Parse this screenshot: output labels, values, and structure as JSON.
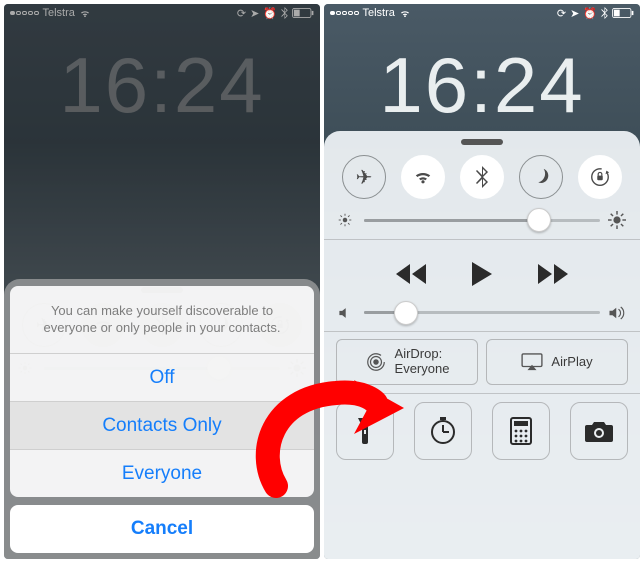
{
  "status": {
    "carrier": "Telstra",
    "clock_left": "16:24",
    "clock_right": "16:24"
  },
  "actionsheet": {
    "message": "You can make yourself discoverable to everyone or only people in your contacts.",
    "opt_off": "Off",
    "opt_contacts": "Contacts Only",
    "opt_everyone": "Everyone",
    "cancel": "Cancel"
  },
  "cc": {
    "airdrop": {
      "label": "AirDrop:",
      "value": "Everyone"
    },
    "airplay": "AirPlay"
  },
  "sliders": {
    "brightness_left_pct": 74,
    "brightness_right_pct": 74,
    "volume_right_pct": 18
  }
}
